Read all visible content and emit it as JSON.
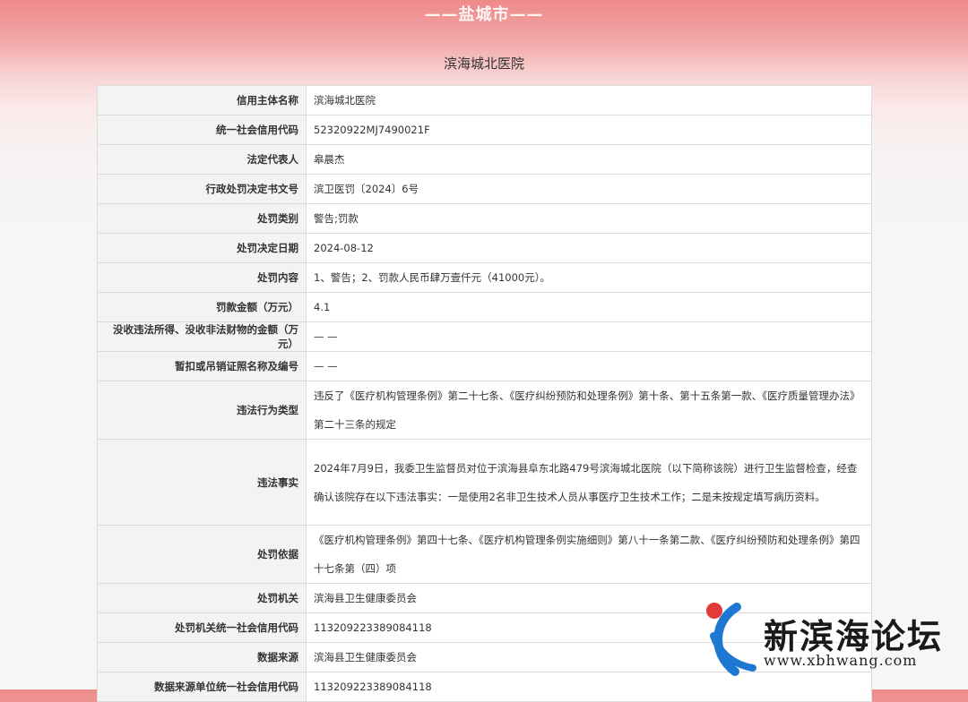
{
  "header": {
    "city": "——盐城市——",
    "title": "滨海城北医院"
  },
  "rows": [
    {
      "label": "信用主体名称",
      "value": "滨海城北医院"
    },
    {
      "label": "统一社会信用代码",
      "value": "52320922MJ7490021F"
    },
    {
      "label": "法定代表人",
      "value": "皋晨杰"
    },
    {
      "label": "行政处罚决定书文号",
      "value": "滨卫医罚〔2024〕6号"
    },
    {
      "label": "处罚类别",
      "value": "警告;罚款"
    },
    {
      "label": "处罚决定日期",
      "value": "2024-08-12"
    },
    {
      "label": "处罚内容",
      "value": "1、警告；2、罚款人民币肆万壹仟元（41000元）。"
    },
    {
      "label": "罚款金额（万元）",
      "value": "4.1"
    },
    {
      "label": "没收违法所得、没收非法财物的金额（万元）",
      "value": "— —"
    },
    {
      "label": "暂扣或吊销证照名称及编号",
      "value": "— —"
    },
    {
      "label": "违法行为类型",
      "value": "违反了《医疗机构管理条例》第二十七条、《医疗纠纷预防和处理条例》第十条、第十五条第一款、《医疗质量管理办法》第二十三条的规定"
    },
    {
      "label": "违法事实",
      "value": "2024年7月9日，我委卫生监督员对位于滨海县阜东北路479号滨海城北医院（以下简称该院）进行卫生监督检查，经查确认该院存在以下违法事实：一是使用2名非卫生技术人员从事医疗卫生技术工作；二是未按规定填写病历资料。"
    },
    {
      "label": "处罚依据",
      "value": "《医疗机构管理条例》第四十七条、《医疗机构管理条例实施细则》第八十一条第二款、《医疗纠纷预防和处理条例》第四十七条第（四）项"
    },
    {
      "label": "处罚机关",
      "value": "滨海县卫生健康委员会"
    },
    {
      "label": "处罚机关统一社会信用代码",
      "value": "11320922338908411​8"
    },
    {
      "label": "数据来源",
      "value": "滨海县卫生健康委员会"
    },
    {
      "label": "数据来源单位统一社会信用代码",
      "value": "113209223389084118"
    }
  ],
  "watermark": {
    "name": "新滨海论坛",
    "url": "www.xbhwang.com"
  },
  "colors": {
    "header_red": "#ee8a8a",
    "logo_blue": "#1e78d2",
    "logo_red": "#e23a3a"
  }
}
